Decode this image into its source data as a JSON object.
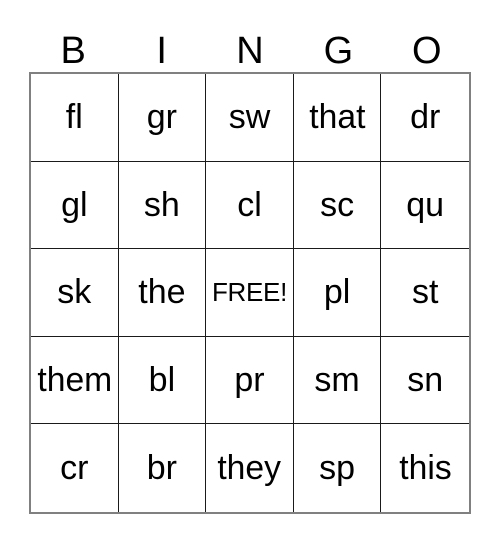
{
  "card": {
    "header": {
      "letters": [
        "B",
        "I",
        "N",
        "G",
        "O"
      ]
    },
    "grid": {
      "rows": 5,
      "columns": 5,
      "border_color": "#808080",
      "cell_border_color": "#1a1a1a",
      "background_color": "#ffffff",
      "text_color": "#000000",
      "free_space": {
        "row": 2,
        "column": 2,
        "label": "FREE!"
      },
      "cells": [
        [
          {
            "text": "fl",
            "style": "normal"
          },
          {
            "text": "gr",
            "style": "normal"
          },
          {
            "text": "sw",
            "style": "normal"
          },
          {
            "text": "that",
            "style": "fit"
          },
          {
            "text": "dr",
            "style": "normal"
          }
        ],
        [
          {
            "text": "gl",
            "style": "normal"
          },
          {
            "text": "sh",
            "style": "normal"
          },
          {
            "text": "cl",
            "style": "normal"
          },
          {
            "text": "sc",
            "style": "normal"
          },
          {
            "text": "qu",
            "style": "normal"
          }
        ],
        [
          {
            "text": "sk",
            "style": "normal"
          },
          {
            "text": "the",
            "style": "normal"
          },
          {
            "text": "FREE!",
            "style": "free"
          },
          {
            "text": "pl",
            "style": "normal"
          },
          {
            "text": "st",
            "style": "normal"
          }
        ],
        [
          {
            "text": "them",
            "style": "fit"
          },
          {
            "text": "bl",
            "style": "normal"
          },
          {
            "text": "pr",
            "style": "normal"
          },
          {
            "text": "sm",
            "style": "normal"
          },
          {
            "text": "sn",
            "style": "normal"
          }
        ],
        [
          {
            "text": "cr",
            "style": "normal"
          },
          {
            "text": "br",
            "style": "normal"
          },
          {
            "text": "they",
            "style": "fit"
          },
          {
            "text": "sp",
            "style": "normal"
          },
          {
            "text": "this",
            "style": "fit"
          }
        ]
      ]
    }
  }
}
